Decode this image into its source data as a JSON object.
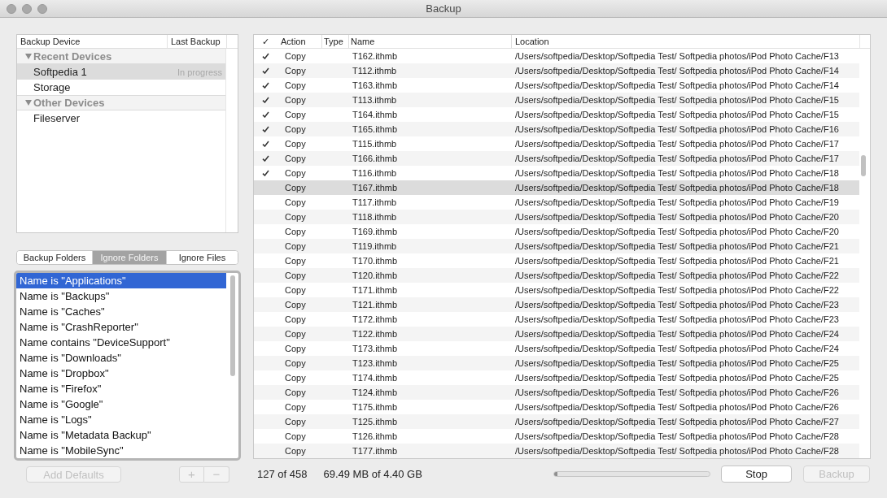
{
  "window": {
    "title": "Backup"
  },
  "devices": {
    "columns": [
      "Backup Device",
      "Last Backup"
    ],
    "groups": [
      {
        "label": "Recent Devices",
        "expanded": true,
        "children": [
          {
            "name": "Softpedia 1",
            "last_backup": "In progress",
            "selected": true
          },
          {
            "name": "Storage",
            "selected": false
          }
        ]
      },
      {
        "label": "Other Devices",
        "expanded": true,
        "children": [
          {
            "name": "Fileserver",
            "selected": false
          }
        ]
      }
    ]
  },
  "folder_tabs": [
    {
      "label": "Backup Folders",
      "selected": false
    },
    {
      "label": "Ignore Folders",
      "selected": true
    },
    {
      "label": "Ignore Files",
      "selected": false
    }
  ],
  "rules": [
    {
      "text": "Name is \"Applications\"",
      "selected": true
    },
    {
      "text": "Name is \"Backups\"",
      "selected": false
    },
    {
      "text": "Name is \"Caches\"",
      "selected": false
    },
    {
      "text": "Name is \"CrashReporter\"",
      "selected": false
    },
    {
      "text": "Name contains \"DeviceSupport\"",
      "selected": false
    },
    {
      "text": "Name is \"Downloads\"",
      "selected": false
    },
    {
      "text": "Name is \"Dropbox\"",
      "selected": false
    },
    {
      "text": "Name is \"Firefox\"",
      "selected": false
    },
    {
      "text": "Name is \"Google\"",
      "selected": false
    },
    {
      "text": "Name is \"Logs\"",
      "selected": false
    },
    {
      "text": "Name is \"Metadata Backup\"",
      "selected": false
    },
    {
      "text": "Name is \"MobileSync\"",
      "selected": false
    }
  ],
  "rule_controls": {
    "add_defaults": {
      "label": "Add Defaults",
      "disabled": true
    },
    "add": {
      "label": "+",
      "disabled": true
    },
    "remove": {
      "label": "−",
      "disabled": true
    }
  },
  "files": {
    "columns": [
      "✓",
      "Action",
      "Type",
      "Name",
      "Location"
    ],
    "rows": [
      {
        "checked": true,
        "action": "Copy",
        "name": "T162.ithmb",
        "location": "/Users/softpedia/Desktop/Softpedia Test/ Softpedia photos/iPod Photo Cache/F13",
        "selected": false
      },
      {
        "checked": true,
        "action": "Copy",
        "name": "T112.ithmb",
        "location": "/Users/softpedia/Desktop/Softpedia Test/ Softpedia photos/iPod Photo Cache/F14",
        "selected": false
      },
      {
        "checked": true,
        "action": "Copy",
        "name": "T163.ithmb",
        "location": "/Users/softpedia/Desktop/Softpedia Test/ Softpedia photos/iPod Photo Cache/F14",
        "selected": false
      },
      {
        "checked": true,
        "action": "Copy",
        "name": "T113.ithmb",
        "location": "/Users/softpedia/Desktop/Softpedia Test/ Softpedia photos/iPod Photo Cache/F15",
        "selected": false
      },
      {
        "checked": true,
        "action": "Copy",
        "name": "T164.ithmb",
        "location": "/Users/softpedia/Desktop/Softpedia Test/ Softpedia photos/iPod Photo Cache/F15",
        "selected": false
      },
      {
        "checked": true,
        "action": "Copy",
        "name": "T165.ithmb",
        "location": "/Users/softpedia/Desktop/Softpedia Test/ Softpedia photos/iPod Photo Cache/F16",
        "selected": false
      },
      {
        "checked": true,
        "action": "Copy",
        "name": "T115.ithmb",
        "location": "/Users/softpedia/Desktop/Softpedia Test/ Softpedia photos/iPod Photo Cache/F17",
        "selected": false
      },
      {
        "checked": true,
        "action": "Copy",
        "name": "T166.ithmb",
        "location": "/Users/softpedia/Desktop/Softpedia Test/ Softpedia photos/iPod Photo Cache/F17",
        "selected": false
      },
      {
        "checked": true,
        "action": "Copy",
        "name": "T116.ithmb",
        "location": "/Users/softpedia/Desktop/Softpedia Test/ Softpedia photos/iPod Photo Cache/F18",
        "selected": false
      },
      {
        "checked": false,
        "action": "Copy",
        "name": "T167.ithmb",
        "location": "/Users/softpedia/Desktop/Softpedia Test/ Softpedia photos/iPod Photo Cache/F18",
        "selected": true
      },
      {
        "checked": false,
        "action": "Copy",
        "name": "T117.ithmb",
        "location": "/Users/softpedia/Desktop/Softpedia Test/ Softpedia photos/iPod Photo Cache/F19",
        "selected": false
      },
      {
        "checked": false,
        "action": "Copy",
        "name": "T118.ithmb",
        "location": "/Users/softpedia/Desktop/Softpedia Test/ Softpedia photos/iPod Photo Cache/F20",
        "selected": false
      },
      {
        "checked": false,
        "action": "Copy",
        "name": "T169.ithmb",
        "location": "/Users/softpedia/Desktop/Softpedia Test/ Softpedia photos/iPod Photo Cache/F20",
        "selected": false
      },
      {
        "checked": false,
        "action": "Copy",
        "name": "T119.ithmb",
        "location": "/Users/softpedia/Desktop/Softpedia Test/ Softpedia photos/iPod Photo Cache/F21",
        "selected": false
      },
      {
        "checked": false,
        "action": "Copy",
        "name": "T170.ithmb",
        "location": "/Users/softpedia/Desktop/Softpedia Test/ Softpedia photos/iPod Photo Cache/F21",
        "selected": false
      },
      {
        "checked": false,
        "action": "Copy",
        "name": "T120.ithmb",
        "location": "/Users/softpedia/Desktop/Softpedia Test/ Softpedia photos/iPod Photo Cache/F22",
        "selected": false
      },
      {
        "checked": false,
        "action": "Copy",
        "name": "T171.ithmb",
        "location": "/Users/softpedia/Desktop/Softpedia Test/ Softpedia photos/iPod Photo Cache/F22",
        "selected": false
      },
      {
        "checked": false,
        "action": "Copy",
        "name": "T121.ithmb",
        "location": "/Users/softpedia/Desktop/Softpedia Test/ Softpedia photos/iPod Photo Cache/F23",
        "selected": false
      },
      {
        "checked": false,
        "action": "Copy",
        "name": "T172.ithmb",
        "location": "/Users/softpedia/Desktop/Softpedia Test/ Softpedia photos/iPod Photo Cache/F23",
        "selected": false
      },
      {
        "checked": false,
        "action": "Copy",
        "name": "T122.ithmb",
        "location": "/Users/softpedia/Desktop/Softpedia Test/ Softpedia photos/iPod Photo Cache/F24",
        "selected": false
      },
      {
        "checked": false,
        "action": "Copy",
        "name": "T173.ithmb",
        "location": "/Users/softpedia/Desktop/Softpedia Test/ Softpedia photos/iPod Photo Cache/F24",
        "selected": false
      },
      {
        "checked": false,
        "action": "Copy",
        "name": "T123.ithmb",
        "location": "/Users/softpedia/Desktop/Softpedia Test/ Softpedia photos/iPod Photo Cache/F25",
        "selected": false
      },
      {
        "checked": false,
        "action": "Copy",
        "name": "T174.ithmb",
        "location": "/Users/softpedia/Desktop/Softpedia Test/ Softpedia photos/iPod Photo Cache/F25",
        "selected": false
      },
      {
        "checked": false,
        "action": "Copy",
        "name": "T124.ithmb",
        "location": "/Users/softpedia/Desktop/Softpedia Test/ Softpedia photos/iPod Photo Cache/F26",
        "selected": false
      },
      {
        "checked": false,
        "action": "Copy",
        "name": "T175.ithmb",
        "location": "/Users/softpedia/Desktop/Softpedia Test/ Softpedia photos/iPod Photo Cache/F26",
        "selected": false
      },
      {
        "checked": false,
        "action": "Copy",
        "name": "T125.ithmb",
        "location": "/Users/softpedia/Desktop/Softpedia Test/ Softpedia photos/iPod Photo Cache/F27",
        "selected": false
      },
      {
        "checked": false,
        "action": "Copy",
        "name": "T126.ithmb",
        "location": "/Users/softpedia/Desktop/Softpedia Test/ Softpedia photos/iPod Photo Cache/F28",
        "selected": false
      },
      {
        "checked": false,
        "action": "Copy",
        "name": "T177.ithmb",
        "location": "/Users/softpedia/Desktop/Softpedia Test/ Softpedia photos/iPod Photo Cache/F28",
        "selected": false
      }
    ]
  },
  "status": {
    "count": "127 of 458",
    "size": "69.49 MB of 4.40 GB",
    "progress": {
      "level": 0.02
    }
  },
  "actions": {
    "stop": {
      "label": "Stop",
      "disabled": false
    },
    "backup": {
      "label": "Backup",
      "disabled": true
    }
  }
}
